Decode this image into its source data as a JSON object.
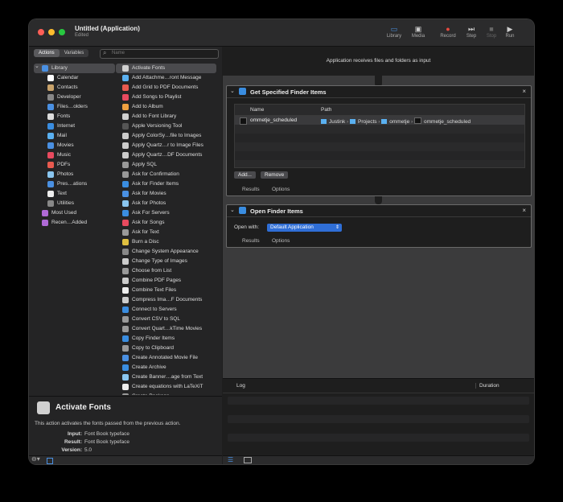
{
  "window": {
    "title": "Untitled (Application)",
    "subtitle": "Edited"
  },
  "toolbar": [
    {
      "label": "Library",
      "icon": "library-icon",
      "color": "#4a90e2"
    },
    {
      "label": "Media",
      "icon": "media-icon",
      "color": "#cccccc"
    },
    {
      "label": "Record",
      "icon": "record-icon",
      "color": "#e84a3f"
    },
    {
      "label": "Step",
      "icon": "step-icon",
      "color": "#cccccc"
    },
    {
      "label": "Stop",
      "icon": "stop-icon",
      "color": "#666666"
    },
    {
      "label": "Run",
      "icon": "run-icon",
      "color": "#cccccc"
    }
  ],
  "left": {
    "tabs": [
      "Actions",
      "Variables"
    ],
    "search_placeholder": "Name",
    "library": [
      {
        "label": "Library",
        "color": "#4a90e2",
        "selected": true
      },
      {
        "label": "Calendar",
        "color": "#ffffff"
      },
      {
        "label": "Contacts",
        "color": "#c9a36b"
      },
      {
        "label": "Developer",
        "color": "#888888"
      },
      {
        "label": "Files…olders",
        "color": "#4a90e2"
      },
      {
        "label": "Fonts",
        "color": "#dddddd"
      },
      {
        "label": "Internet",
        "color": "#3a8de0"
      },
      {
        "label": "Mail",
        "color": "#5ab0f0"
      },
      {
        "label": "Movies",
        "color": "#4a90e2"
      },
      {
        "label": "Music",
        "color": "#e84a5f"
      },
      {
        "label": "PDFs",
        "color": "#e85a4f"
      },
      {
        "label": "Photos",
        "color": "#8ac6f0"
      },
      {
        "label": "Pres…ations",
        "color": "#4a90e2"
      },
      {
        "label": "Text",
        "color": "#eeeeee"
      },
      {
        "label": "Utilities",
        "color": "#888888"
      },
      {
        "label": "Most Used",
        "color": "#b06ad6"
      },
      {
        "label": "Recen…Added",
        "color": "#b06ad6"
      }
    ],
    "actions": [
      {
        "label": "Activate Fonts",
        "color": "#d0d0d0",
        "selected": true
      },
      {
        "label": "Add Attachme…ront Message",
        "color": "#5ab0f0"
      },
      {
        "label": "Add Grid to PDF Documents",
        "color": "#e85a4f"
      },
      {
        "label": "Add Songs to Playlist",
        "color": "#e84a5f"
      },
      {
        "label": "Add to Album",
        "color": "#f0a040"
      },
      {
        "label": "Add to Font Library",
        "color": "#d0d0d0"
      },
      {
        "label": "Apple Versioning Tool",
        "color": "#555555"
      },
      {
        "label": "Apply ColorSy…file to Images",
        "color": "#cccccc"
      },
      {
        "label": "Apply Quartz…r to Image Files",
        "color": "#cccccc"
      },
      {
        "label": "Apply Quartz…DF Documents",
        "color": "#cccccc"
      },
      {
        "label": "Apply SQL",
        "color": "#999999"
      },
      {
        "label": "Ask for Confirmation",
        "color": "#999999"
      },
      {
        "label": "Ask for Finder Items",
        "color": "#3a8de0"
      },
      {
        "label": "Ask for Movies",
        "color": "#4a90e2"
      },
      {
        "label": "Ask for Photos",
        "color": "#8ac6f0"
      },
      {
        "label": "Ask For Servers",
        "color": "#3a8de0"
      },
      {
        "label": "Ask for Songs",
        "color": "#e84a5f"
      },
      {
        "label": "Ask for Text",
        "color": "#999999"
      },
      {
        "label": "Burn a Disc",
        "color": "#e0c040"
      },
      {
        "label": "Change System Appearance",
        "color": "#888888"
      },
      {
        "label": "Change Type of Images",
        "color": "#cccccc"
      },
      {
        "label": "Choose from List",
        "color": "#999999"
      },
      {
        "label": "Combine PDF Pages",
        "color": "#cccccc"
      },
      {
        "label": "Combine Text Files",
        "color": "#eeeeee"
      },
      {
        "label": "Compress Ima…F Documents",
        "color": "#cccccc"
      },
      {
        "label": "Connect to Servers",
        "color": "#3a8de0"
      },
      {
        "label": "Convert CSV to SQL",
        "color": "#999999"
      },
      {
        "label": "Convert Quart…kTime Movies",
        "color": "#999999"
      },
      {
        "label": "Copy Finder Items",
        "color": "#3a8de0"
      },
      {
        "label": "Copy to Clipboard",
        "color": "#999999"
      },
      {
        "label": "Create Annotated Movie File",
        "color": "#4a90e2"
      },
      {
        "label": "Create Archive",
        "color": "#3a8de0"
      },
      {
        "label": "Create Banner…age from Text",
        "color": "#8ac6f0"
      },
      {
        "label": "Create equations with LaTeXiT",
        "color": "#eeeeee"
      },
      {
        "label": "Create Package",
        "color": "#999999"
      }
    ]
  },
  "info": {
    "title": "Activate Fonts",
    "description": "This action activates the fonts passed from the previous action.",
    "input_label": "Input:",
    "input_value": "Font Book typeface",
    "result_label": "Result:",
    "result_value": "Font Book typeface",
    "version_label": "Version:",
    "version_value": "5.0"
  },
  "workflow": {
    "header": "Application receives files and folders as input",
    "card1": {
      "title": "Get Specified Finder Items",
      "col_name": "Name",
      "col_path": "Path",
      "row_name": "ommetje_scheduled",
      "path": [
        "Justink",
        "Projects",
        "ommetje",
        "ommetje_scheduled"
      ],
      "add": "Add...",
      "remove": "Remove",
      "results": "Results",
      "options": "Options"
    },
    "card2": {
      "title": "Open Finder Items",
      "open_with_label": "Open with:",
      "open_with_value": "Default Application",
      "results": "Results",
      "options": "Options"
    }
  },
  "log": {
    "col_log": "Log",
    "col_duration": "Duration"
  }
}
